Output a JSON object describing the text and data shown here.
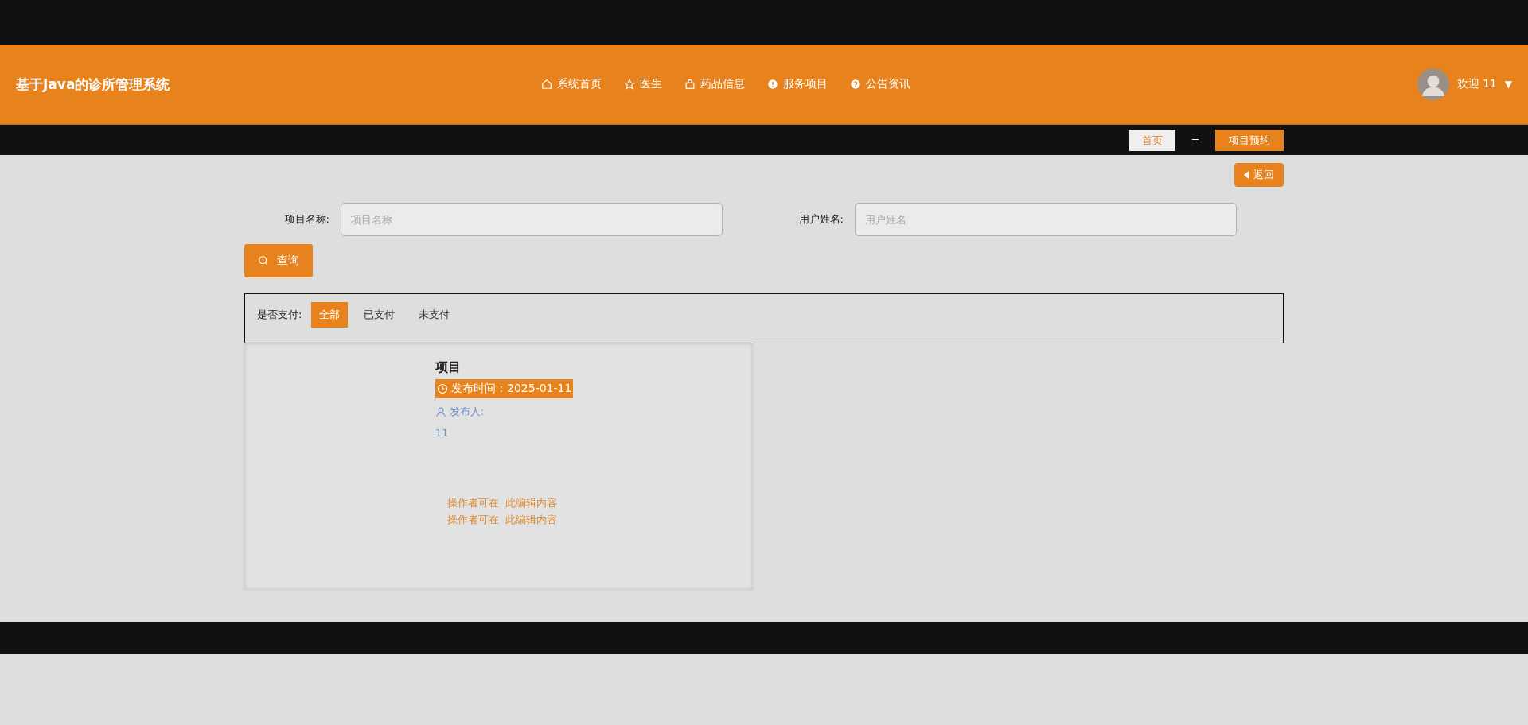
{
  "header": {
    "title": "基于Java的诊所管理系统",
    "nav": [
      {
        "label": "系统首页",
        "kind": "home"
      },
      {
        "label": "医生",
        "kind": "star"
      },
      {
        "label": "药品信息",
        "kind": "bag"
      },
      {
        "label": "服务项目",
        "kind": "info"
      },
      {
        "label": "公告资讯",
        "kind": "help"
      }
    ],
    "user": {
      "greeting": "欢迎 11",
      "caret": "▼"
    }
  },
  "breadcrumb": {
    "items": [
      {
        "label": "首页",
        "kind": "home"
      },
      {
        "label": "=",
        "kind": "separator"
      },
      {
        "label": "项目预约",
        "kind": "current"
      }
    ]
  },
  "back_button": {
    "label": "返回"
  },
  "search": {
    "fields": [
      {
        "label": "项目名称:",
        "placeholder": "项目名称"
      },
      {
        "label": "用户姓名:",
        "placeholder": "用户姓名"
      }
    ],
    "button": "查询"
  },
  "filter": {
    "label": "是否支付:",
    "options": [
      {
        "label": "全部",
        "selected": true
      },
      {
        "label": "已支付",
        "selected": false
      },
      {
        "label": "未支付",
        "selected": false
      }
    ]
  },
  "cards": [
    {
      "title": "项目",
      "time": "发布时间：2025-01-11",
      "author_label": "发布人:",
      "author": "11",
      "notes": [
        "操作者可在  此编辑内容",
        "操作者可在  此编辑内容"
      ]
    }
  ]
}
